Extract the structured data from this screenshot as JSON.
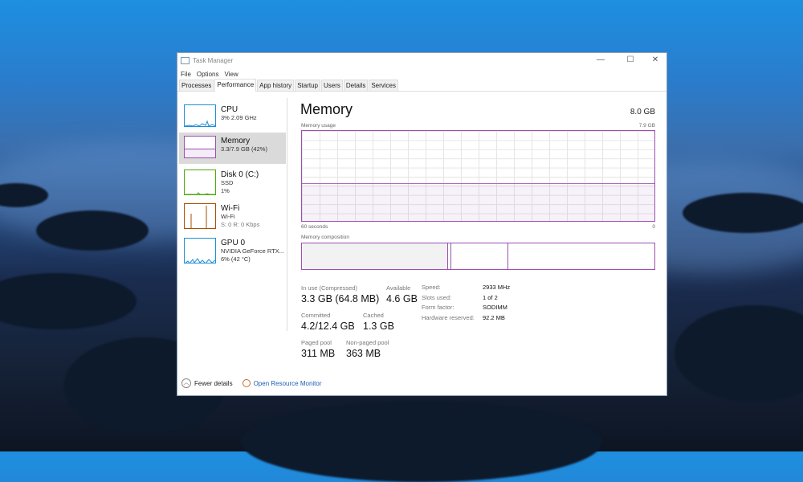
{
  "window": {
    "title": "Task Manager",
    "controls": {
      "minimize": "—",
      "maximize": "☐",
      "close": "✕"
    }
  },
  "menu": [
    "File",
    "Options",
    "View"
  ],
  "tabs": [
    "Processes",
    "Performance",
    "App history",
    "Startup",
    "Users",
    "Details",
    "Services"
  ],
  "active_tab": "Performance",
  "sidebar": [
    {
      "title": "CPU",
      "line1": "3% 2.09 GHz",
      "line2": "",
      "color": "#1c8fd6"
    },
    {
      "title": "Memory",
      "line1": "3.3/7.9 GB (42%)",
      "line2": "",
      "color": "#9b4fb2"
    },
    {
      "title": "Disk 0 (C:)",
      "line1": "SSD",
      "line2": "1%",
      "color": "#4da60c"
    },
    {
      "title": "Wi-Fi",
      "line1": "Wi-Fi",
      "line2": "S: 0 R: 0 Kbps",
      "color": "#a74f01"
    },
    {
      "title": "GPU 0",
      "line1": "NVIDIA GeForce RTX...",
      "line2": "6% (42 °C)",
      "color": "#1c8fd6"
    }
  ],
  "main": {
    "title": "Memory",
    "total": "8.0 GB",
    "usage_label": "Memory usage",
    "usage_max": "7.9 GB",
    "time_left": "60 seconds",
    "time_right": "0",
    "usage_fraction": 0.42,
    "composition_label": "Memory composition",
    "stats": {
      "in_use_label": "In use (Compressed)",
      "in_use": "3.3 GB (64.8 MB)",
      "available_label": "Available",
      "available": "4.6 GB",
      "committed_label": "Committed",
      "committed": "4.2/12.4 GB",
      "cached_label": "Cached",
      "cached": "1.3 GB",
      "paged_label": "Paged pool",
      "paged": "311 MB",
      "nonpaged_label": "Non-paged pool",
      "nonpaged": "363 MB"
    },
    "specs": [
      {
        "k": "Speed:",
        "v": "2933 MHz"
      },
      {
        "k": "Slots used:",
        "v": "1 of 2"
      },
      {
        "k": "Form factor:",
        "v": "SODIMM"
      },
      {
        "k": "Hardware reserved:",
        "v": "92.2 MB"
      }
    ]
  },
  "footer": {
    "fewer": "Fewer details",
    "monitor": "Open Resource Monitor"
  }
}
